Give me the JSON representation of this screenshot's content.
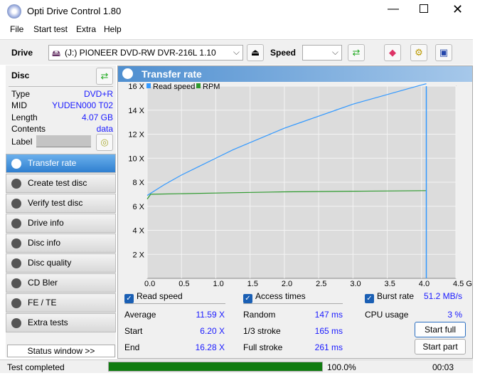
{
  "window": {
    "title": "Opti Drive Control 1.80"
  },
  "menu": [
    "File",
    "Start test",
    "Extra",
    "Help"
  ],
  "toolbar": {
    "drive_label": "Drive",
    "drive_value": "(J:)  PIONEER DVD-RW  DVR-216L 1.10",
    "speed_label": "Speed"
  },
  "disc": {
    "header": "Disc",
    "type_label": "Type",
    "type": "DVD+R",
    "mid_label": "MID",
    "mid": "YUDEN000 T02",
    "length_label": "Length",
    "length": "4.07 GB",
    "contents_label": "Contents",
    "contents": "data",
    "label_label": "Label"
  },
  "nav": [
    "Transfer rate",
    "Create test disc",
    "Verify test disc",
    "Drive info",
    "Disc info",
    "Disc quality",
    "CD Bler",
    "FE / TE",
    "Extra tests"
  ],
  "status_window": "Status window >>",
  "panel_title": "Transfer rate",
  "chart_data": {
    "type": "line",
    "legend": [
      "Read speed",
      "RPM"
    ],
    "legend_placement": "top-left",
    "xlabel": "GB",
    "xlim": [
      0,
      4.5
    ],
    "ylim": [
      0,
      16
    ],
    "x_ticks": [
      "0.0",
      "0.5",
      "1.0",
      "1.5",
      "2.0",
      "2.5",
      "3.0",
      "3.5",
      "4.0",
      "4.5 GB"
    ],
    "y_ticks": [
      "2 X",
      "4 X",
      "6 X",
      "8 X",
      "10 X",
      "12 X",
      "14 X",
      "16 X"
    ],
    "series": [
      {
        "name": "Read speed",
        "color": "#3399ff",
        "x": [
          0,
          0.25,
          0.5,
          0.75,
          1.0,
          1.25,
          1.5,
          1.75,
          2.0,
          2.25,
          2.5,
          2.75,
          3.0,
          3.25,
          3.5,
          3.75,
          4.0,
          4.07
        ],
        "y": [
          6.9,
          7.8,
          8.6,
          9.3,
          10.0,
          10.7,
          11.3,
          11.9,
          12.5,
          13.0,
          13.5,
          14.0,
          14.5,
          14.9,
          15.3,
          15.7,
          16.1,
          16.2
        ]
      },
      {
        "name": "RPM",
        "color": "#2e9a2e",
        "x": [
          0,
          0.05,
          1.0,
          2.0,
          3.0,
          4.07
        ],
        "y": [
          6.6,
          7.0,
          7.1,
          7.2,
          7.25,
          7.3
        ]
      }
    ],
    "end_marker": 4.07
  },
  "stats": {
    "read_speed": "Read speed",
    "average_label": "Average",
    "average": "11.59 X",
    "start_label": "Start",
    "start": "6.20 X",
    "end_label": "End",
    "end": "16.28 X",
    "access_times": "Access times",
    "random_label": "Random",
    "random": "147 ms",
    "third_label": "1/3 stroke",
    "third": "165 ms",
    "full_label": "Full stroke",
    "full": "261 ms",
    "burst_label": "Burst rate",
    "burst": "51.2 MB/s",
    "cpu_label": "CPU usage",
    "cpu": "3 %",
    "start_full": "Start full",
    "start_part": "Start part"
  },
  "status": {
    "text": "Test completed",
    "progress": 100,
    "progress_text": "100.0%",
    "time": "00:03"
  }
}
